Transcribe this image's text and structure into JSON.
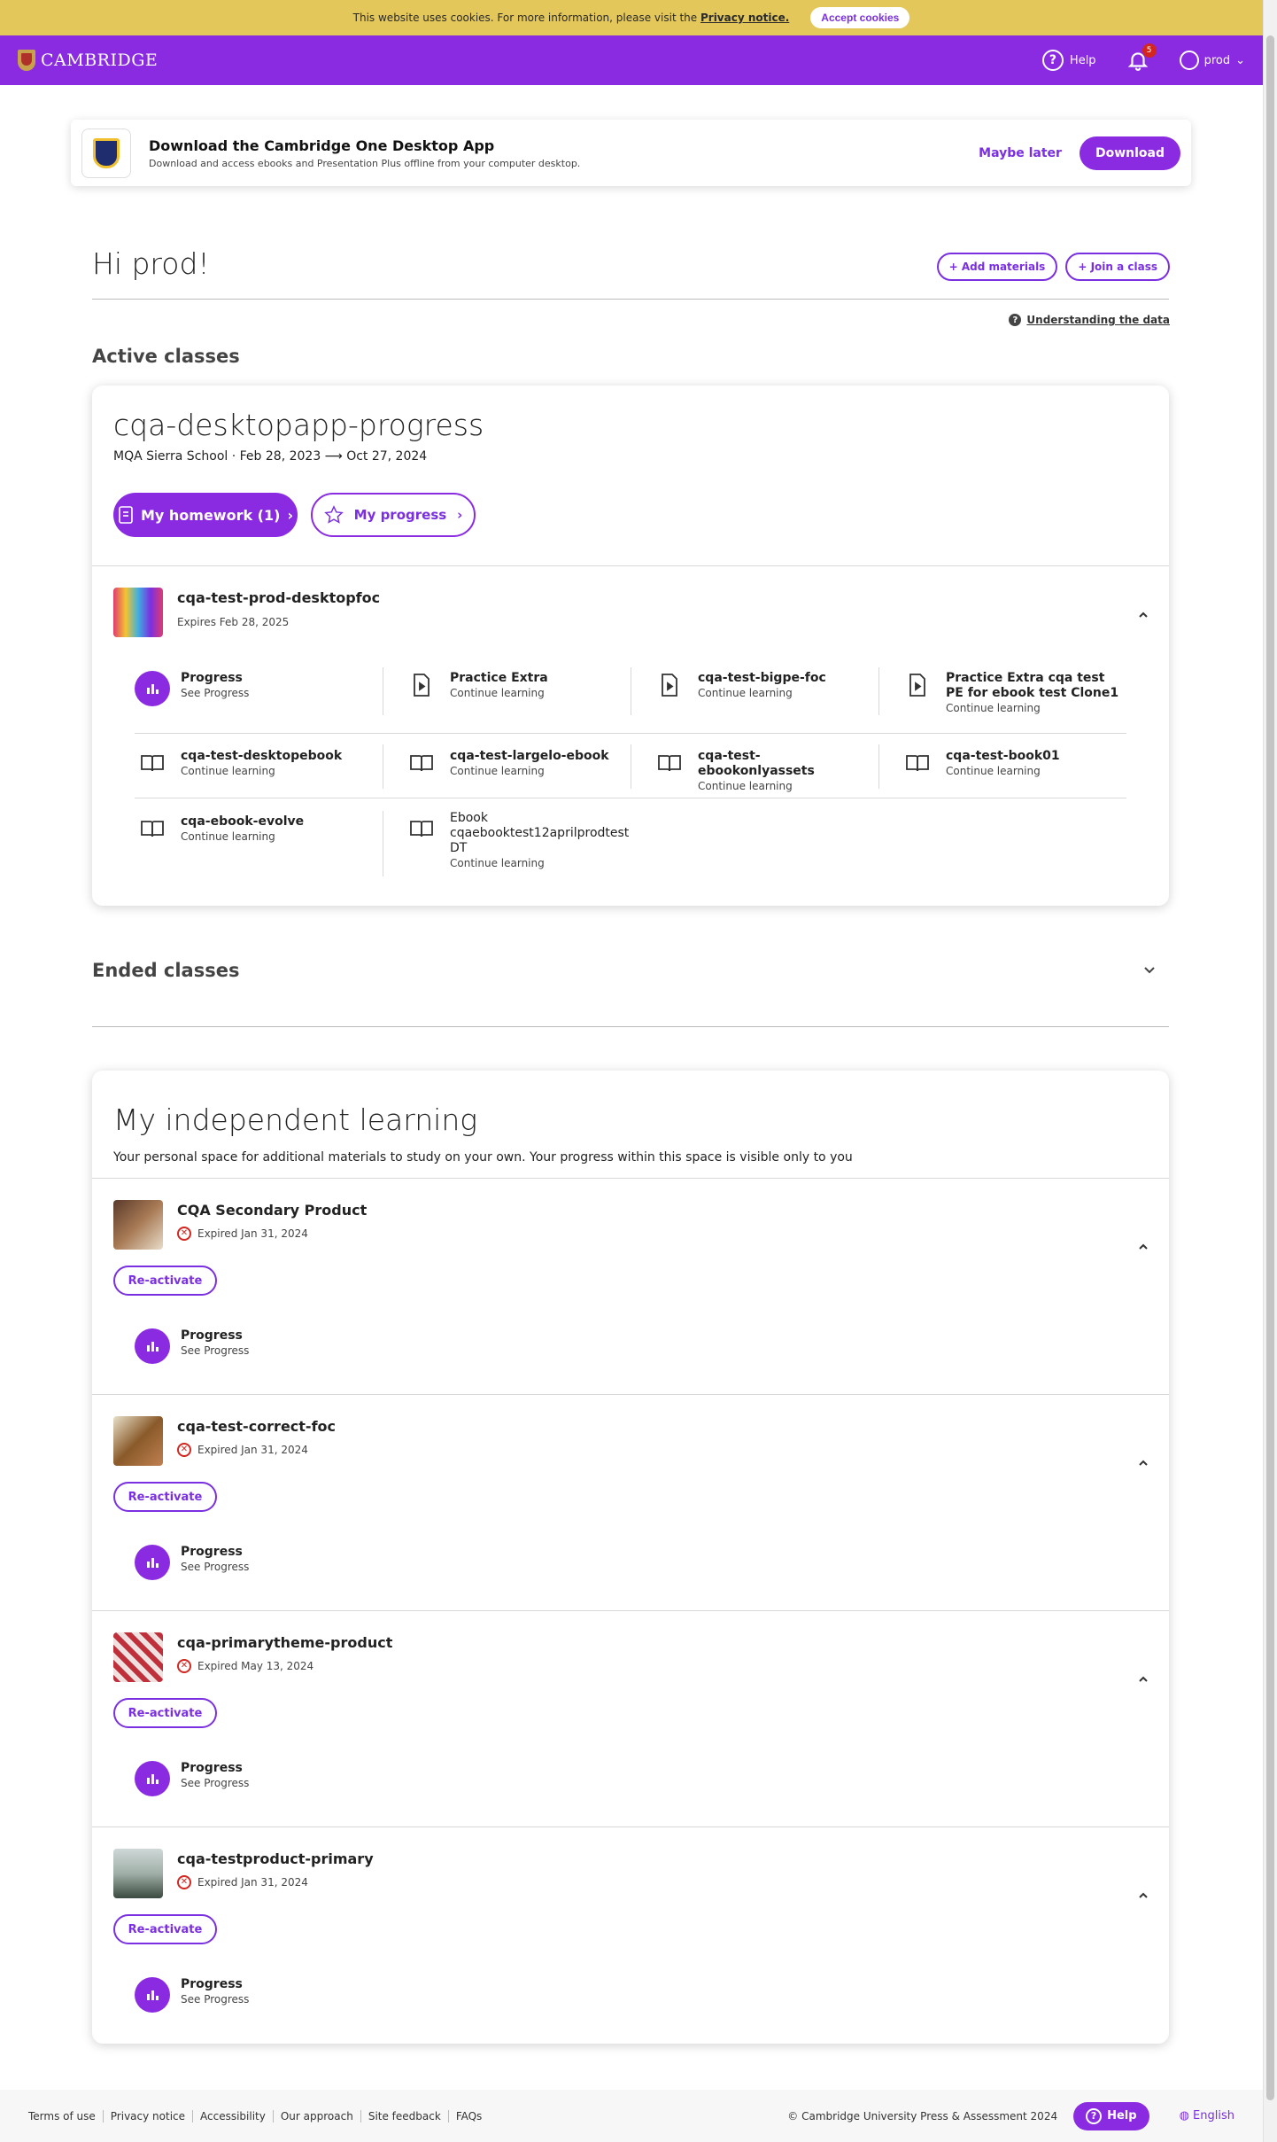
{
  "cookie": {
    "text": "This website uses cookies. For more information, please visit the",
    "link": "Privacy notice.",
    "accept": "Accept cookies"
  },
  "header": {
    "logo": "CAMBRIDGE",
    "help": "Help",
    "notif_count": "5",
    "user": "prod"
  },
  "download_banner": {
    "title": "Download the Cambridge One Desktop App",
    "subtitle": "Download and access ebooks and Presentation Plus offline from your computer desktop.",
    "maybe_later": "Maybe later",
    "download": "Download"
  },
  "greeting": "Hi prod!",
  "add_materials": "Add materials",
  "join_class": "Join a class",
  "understanding": "Understanding the data",
  "active_classes": "Active classes",
  "class": {
    "name": "cqa-desktopapp-progress",
    "meta": "MQA Sierra School  ·  Feb 28, 2023 ⟶ Oct 27, 2024",
    "homework": "My homework (1)",
    "progress": "My progress",
    "product": {
      "name": "cqa-test-prod-desktopfoc",
      "expires": "Expires Feb 28, 2025"
    },
    "items": [
      {
        "name": "Progress",
        "sub": "See Progress",
        "icon": "progress-icon"
      },
      {
        "name": "Practice Extra",
        "sub": "Continue learning",
        "icon": "practice-doc-icon"
      },
      {
        "name": "cqa-test-bigpe-foc",
        "sub": "Continue learning",
        "icon": "practice-doc-icon"
      },
      {
        "name": "Practice Extra cqa test PE for ebook test Clone1",
        "sub": "Continue learning",
        "icon": "practice-doc-icon"
      },
      {
        "name": "cqa-test-desktopebook",
        "sub": "Continue learning",
        "icon": "book-icon"
      },
      {
        "name": "cqa-test-largelo-ebook",
        "sub": "Continue learning",
        "icon": "book-icon"
      },
      {
        "name": "cqa-test-ebookonlyassets",
        "sub": "Continue learning",
        "icon": "book-icon"
      },
      {
        "name": "cqa-test-book01",
        "sub": "Continue learning",
        "icon": "book-icon"
      },
      {
        "name": "cqa-ebook-evolve",
        "sub": "Continue learning",
        "icon": "book-icon"
      },
      {
        "name": "Ebook cqaebooktest12aprilprodtest DT",
        "sub": "Continue learning",
        "icon": "book-icon"
      }
    ]
  },
  "ended_classes": "Ended classes",
  "independent": {
    "title": "My independent learning",
    "subtitle": "Your personal space for additional materials to study on your own. Your progress within this space is visible only to you",
    "reactivate": "Re-activate",
    "progress": "Progress",
    "see_progress": "See Progress",
    "products": [
      {
        "name": "CQA Secondary Product",
        "expired": "Expired Jan 31, 2024"
      },
      {
        "name": "cqa-test-correct-foc",
        "expired": "Expired Jan 31, 2024"
      },
      {
        "name": "cqa-primarytheme-product",
        "expired": "Expired May 13, 2024"
      },
      {
        "name": "cqa-testproduct-primary",
        "expired": "Expired Jan 31, 2024"
      }
    ]
  },
  "footer": {
    "links": [
      "Terms of use",
      "Privacy notice",
      "Accessibility",
      "Our approach",
      "Site feedback",
      "FAQs"
    ],
    "copyright": "© Cambridge University Press & Assessment 2024",
    "help": "Help",
    "language": "English"
  }
}
